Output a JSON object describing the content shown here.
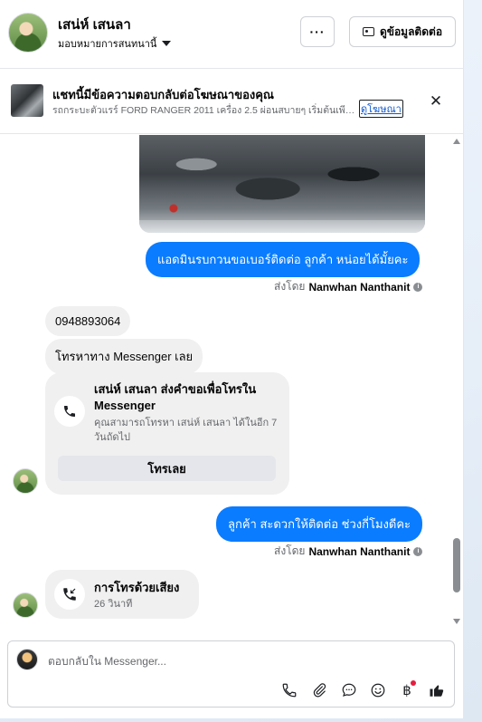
{
  "header": {
    "contact_name": "เสน่ห์ เสนลา",
    "assign_label": "มอบหมายการสนทนานี้",
    "more_label": "···",
    "contact_info_label": "ดูข้อมูลติดต่อ"
  },
  "ad_banner": {
    "title": "แชทนี้มีข้อความตอบกลับต่อโฆษณาของคุณ",
    "description": "รถกระบะตัวแรร์ FORD RANGER 2011 เครื่อง 2.5 ผ่อนสบายๆ เริ่มต้นเพียง...",
    "link_label": "ดูโฆษณา",
    "close_label": "✕"
  },
  "messages": {
    "out_1": "แอดมินรบกวนขอเบอร์ติดต่อ ลูกค้า หน่อยได้มั้ยคะ",
    "sent_by_prefix": "ส่งโดย",
    "sent_by_name": "Nanwhan Nanthanit",
    "in_phone": "0948893064",
    "in_messenger": "โทรหาทาง Messenger เลย",
    "call_request_title": "เสน่ห์ เสนลา ส่งคำขอเพื่อโทรใน Messenger",
    "call_request_sub": "คุณสามารถโทรหา เสน่ห์ เสนลา ได้ในอีก 7 วันถัดไป",
    "call_now_label": "โทรเลย",
    "out_2": "ลูกค้า สะดวกให้ติดต่อ ช่วงกี่โมงดีคะ",
    "voice_call_title": "การโทรด้วยเสียง",
    "voice_call_duration": "26 วินาที"
  },
  "composer": {
    "placeholder": "ตอบกลับใน Messenger..."
  },
  "icons": {
    "phone": "phone-icon",
    "attach": "paperclip-icon",
    "saved_replies": "chat-bubble-icon",
    "emoji": "emoji-icon",
    "payment": "baht-icon",
    "like": "thumbs-up-icon"
  },
  "colors": {
    "outgoing_bubble": "#0a7cff",
    "incoming_bubble": "#f0f0f0",
    "notification_dot": "#e41e3f"
  }
}
